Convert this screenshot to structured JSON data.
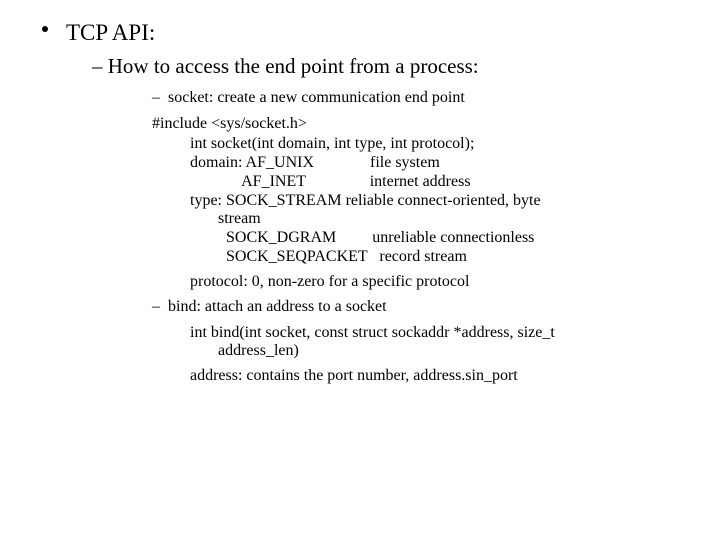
{
  "l1": "TCP API:",
  "l2": "How to access the end point from a process:",
  "socket": {
    "heading": "socket: create a new communication end point",
    "include": "#include <sys/socket.h>",
    "sig": "int socket(int domain, int type, int protocol);",
    "domain_line1": "domain: AF_UNIX              file system",
    "domain_line2": "             AF_INET                internet address",
    "type_line1a": "type: SOCK_STREAM        reliable connect-oriented, byte",
    "type_line1b": "stream",
    "type_line2": "         SOCK_DGRAM         unreliable connectionless",
    "type_line3": "         SOCK_SEQPACKET   record stream",
    "protocol": "protocol: 0, non-zero for a specific protocol"
  },
  "bind": {
    "heading": "bind: attach an address to a socket",
    "sig1": "int bind(int socket, const struct sockaddr *address, size_t",
    "sig2": "address_len)",
    "address": "address: contains the port number, address.sin_port"
  }
}
